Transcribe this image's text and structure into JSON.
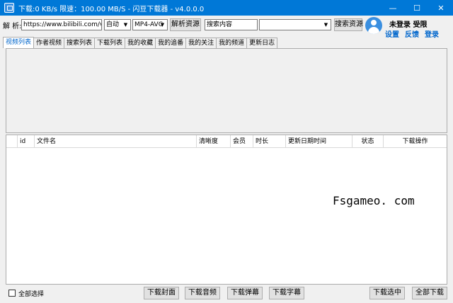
{
  "window": {
    "title": "下载:0 KB/s   限速：100.00 MB/S  - 闪豆下载器 - v4.0.0.0",
    "minimize": "—",
    "maximize": "☐",
    "close": "✕"
  },
  "toolbar": {
    "parse_label": "解 析:",
    "url_value": "https://www.bilibili.com/v",
    "quality_value": "自动",
    "codec_value": "MP4-AVC",
    "parse_button": "解析资源",
    "search_value": "搜索内容",
    "search_type_value": "",
    "search_button": "搜索资源"
  },
  "user": {
    "status": "未登录  受限",
    "links": [
      "设置",
      "反馈",
      "登录"
    ]
  },
  "tabs": [
    "视频列表",
    "作者视频",
    "搜索列表",
    "下载列表",
    "我的收藏",
    "我的追番",
    "我的关注",
    "我的频道",
    "更新日志"
  ],
  "table": {
    "columns": [
      "",
      "id",
      "文件名",
      "清晰度",
      "会员",
      "时长",
      "更新日期时间",
      "状态",
      "下载操作"
    ]
  },
  "watermark": "Fsgameo. com",
  "bottom": {
    "select_all": "全部选择",
    "buttons": [
      "下载封面",
      "下载音频",
      "下载弹幕",
      "下载字幕",
      "下载选中",
      "全部下载"
    ]
  }
}
